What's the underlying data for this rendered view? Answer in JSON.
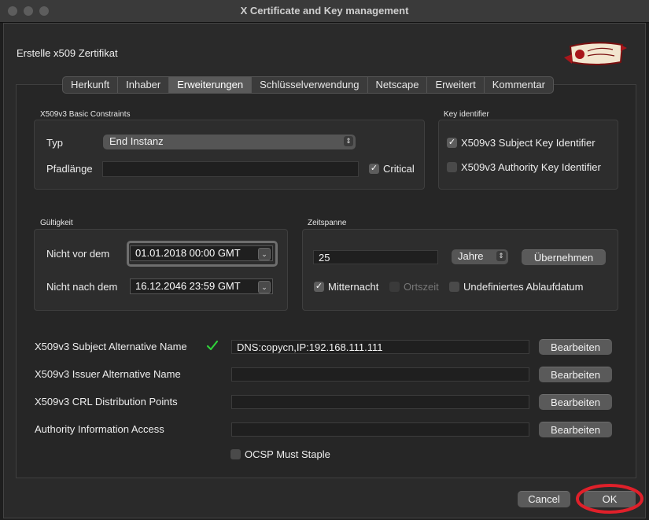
{
  "window": {
    "title": "X Certificate and Key management"
  },
  "dialog": {
    "heading": "Erstelle x509 Zertifikat"
  },
  "tabs": [
    "Herkunft",
    "Inhaber",
    "Erweiterungen",
    "Schlüsselverwendung",
    "Netscape",
    "Erweitert",
    "Kommentar"
  ],
  "active_tab": "Erweiterungen",
  "basic_constraints": {
    "title": "X509v3 Basic Constraints",
    "typ_label": "Typ",
    "typ_value": "End Instanz",
    "pfadlaenge_label": "Pfadlänge",
    "pfadlaenge_value": "",
    "critical_label": "Critical",
    "critical_checked": true
  },
  "key_identifier": {
    "title": "Key identifier",
    "subject_label": "X509v3 Subject Key Identifier",
    "subject_checked": true,
    "authority_label": "X509v3 Authority Key Identifier",
    "authority_checked": false
  },
  "validity": {
    "title": "Gültigkeit",
    "not_before_label": "Nicht vor dem",
    "not_before_value": "01.01.2018 00:00 GMT",
    "not_after_label": "Nicht nach dem",
    "not_after_value": "16.12.2046 23:59 GMT"
  },
  "timespan": {
    "title": "Zeitspanne",
    "amount": "25",
    "unit": "Jahre",
    "apply_label": "Übernehmen",
    "midnight_label": "Mitternacht",
    "midnight_checked": true,
    "localtime_label": "Ortszeit",
    "localtime_checked": false,
    "undefined_label": "Undefiniertes Ablaufdatum",
    "undefined_checked": false
  },
  "extensions": [
    {
      "label": "X509v3 Subject Alternative Name",
      "value": "DNS:copycn,IP:192.168.111.111",
      "valid": true,
      "button": "Bearbeiten"
    },
    {
      "label": "X509v3 Issuer Alternative Name",
      "value": "",
      "valid": false,
      "button": "Bearbeiten"
    },
    {
      "label": "X509v3 CRL Distribution Points",
      "value": "",
      "valid": false,
      "button": "Bearbeiten"
    },
    {
      "label": "Authority Information Access",
      "value": "",
      "valid": false,
      "button": "Bearbeiten"
    }
  ],
  "ocsp": {
    "label": "OCSP Must Staple",
    "checked": false
  },
  "footer": {
    "cancel_label": "Cancel",
    "ok_label": "OK"
  },
  "icons": {
    "valid": "checkmark-icon",
    "seal": "certificate-seal-icon"
  },
  "colors": {
    "annotation_circle": "#e0202a",
    "check_green": "#2fcf3a",
    "seal_red": "#a8161b"
  }
}
